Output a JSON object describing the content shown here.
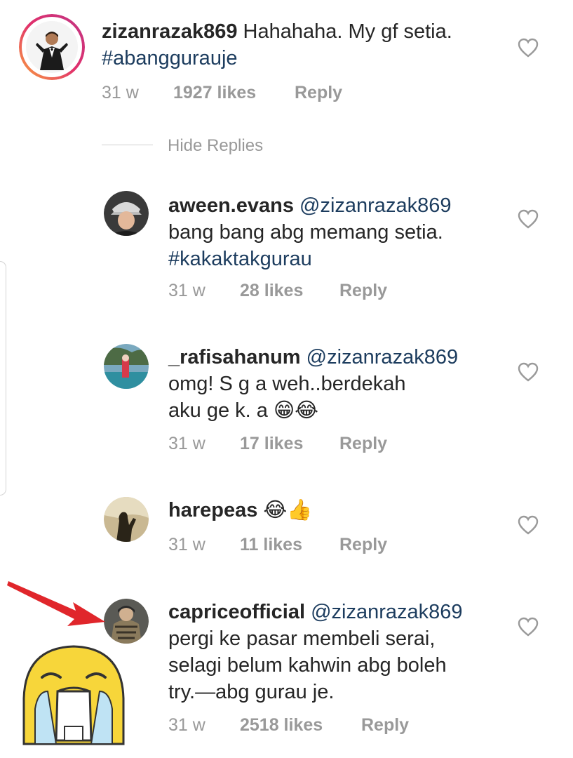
{
  "main_comment": {
    "username": "zizanrazak869",
    "text": "Hahahaha. My gf setia.",
    "hashtag": "#abanggurauje",
    "time": "31 w",
    "likes": "1927 likes",
    "reply": "Reply"
  },
  "hide_replies": "Hide Replies",
  "replies": [
    {
      "username": "aween.evans",
      "mention": "@zizanrazak869",
      "line1": "bang bang abg memang setia.",
      "hashtag": "#kakaktakgurau",
      "time": "31 w",
      "likes": "28 likes",
      "reply": "Reply"
    },
    {
      "username": "_rafisahanum",
      "mention": "@zizanrazak869",
      "line1": "omg! S     g    a weh..berdekah",
      "line2": "aku ge   k.      a",
      "emoji": "😁😂",
      "time": "31 w",
      "likes": "17 likes",
      "reply": "Reply"
    },
    {
      "username": "harepeas",
      "emoji": "😂👍",
      "time": "31 w",
      "likes": "11 likes",
      "reply": "Reply"
    },
    {
      "username": "capriceofficial",
      "mention": "@zizanrazak869",
      "line1": "pergi ke pasar membeli serai,",
      "line2": "selagi belum kahwin abg boleh",
      "line3": "try.—abg gurau je.",
      "time": "31 w",
      "likes": "2518 likes",
      "reply": "Reply"
    }
  ],
  "colors": {
    "text": "#262626",
    "meta": "#999999",
    "hashtag": "#1c3c5e",
    "story_ring_start": "#f9a03f",
    "story_ring_end": "#d6249f",
    "arrow": "#e0262b",
    "emoji_yellow": "#f7d63a"
  }
}
